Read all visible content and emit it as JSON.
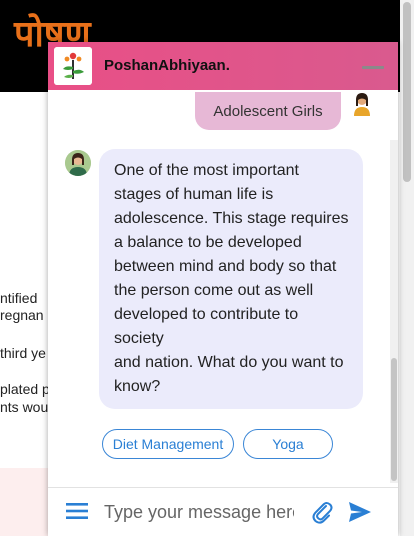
{
  "background": {
    "logo_text": "पोषण",
    "text_lines": [
      "ntified",
      "regnan",
      "third ye",
      "plated p",
      "nts wou"
    ]
  },
  "chat": {
    "title": "PoshanAbhiyaan.",
    "user_message": "Adolescent Girls",
    "bot_message_lines": [
      "One of the most important",
      "stages of human life is",
      "adolescence. This stage requires",
      "a balance to be developed",
      "between mind and body so that",
      "the person come out as well",
      "developed to contribute to",
      "society",
      "and nation. What do you want to",
      "know?"
    ],
    "options": [
      "Diet Management",
      "Yoga"
    ],
    "input_placeholder": "Type your message here"
  },
  "colors": {
    "header": "#e94f86",
    "user_bubble": "#e7b8d6",
    "bot_bubble": "#ebebfb",
    "accent": "#2a7fd4"
  },
  "icons": {
    "menu": "hamburger-icon",
    "attach": "paperclip-icon",
    "send": "send-icon",
    "minimize": "minimize-icon"
  }
}
